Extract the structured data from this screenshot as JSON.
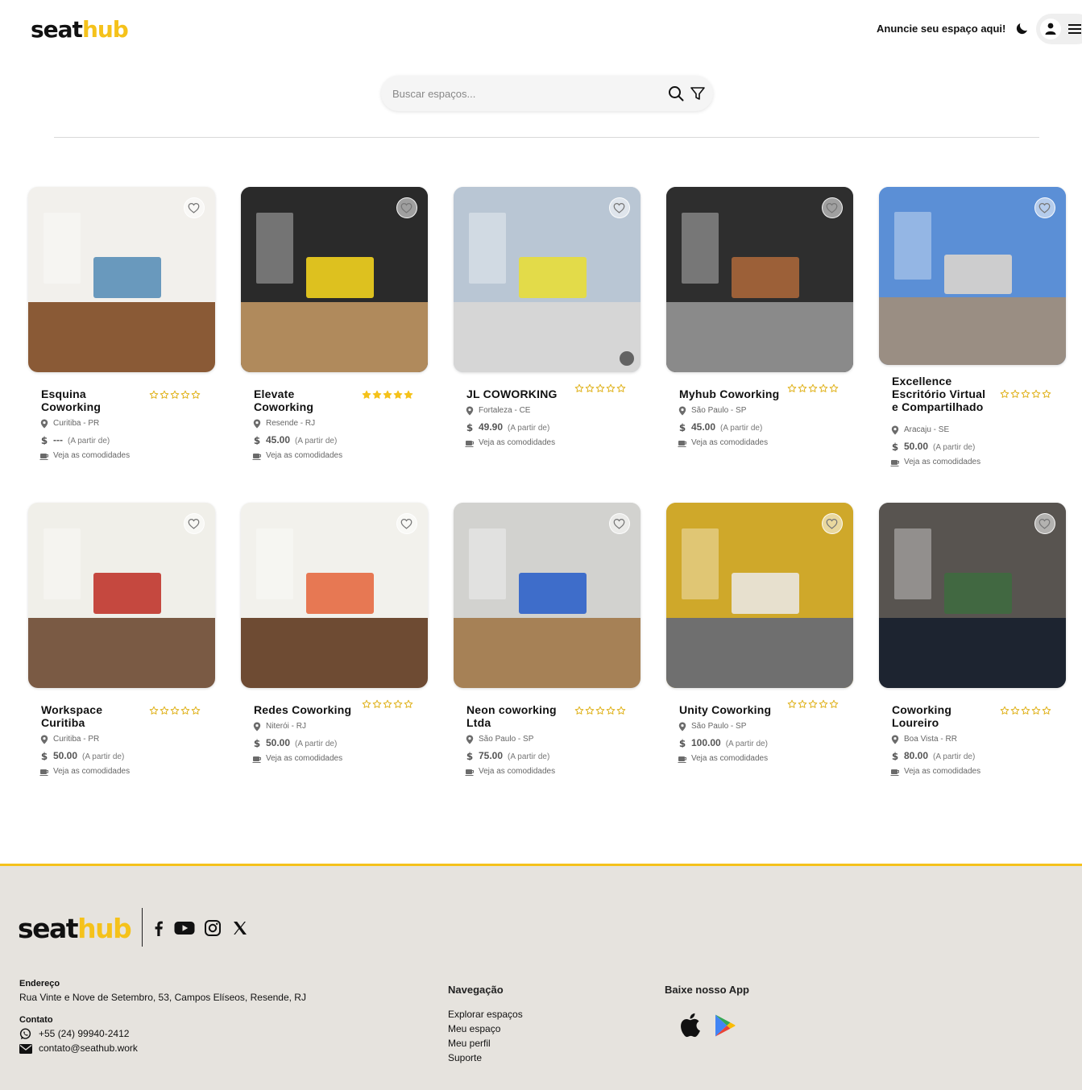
{
  "header": {
    "logo_seat": "seat",
    "logo_hub": "hub",
    "announce_label": "Anuncie seu espaço aqui!"
  },
  "search": {
    "placeholder": "Buscar espaços..."
  },
  "listing_labels": {
    "from": "(A partir de)",
    "amenities": "Veja as comodidades"
  },
  "listings": [
    {
      "name": "Esquina Coworking",
      "rating": 0,
      "location": "Curitiba - PR",
      "price": "---"
    },
    {
      "name": "Elevate Coworking",
      "rating": 5,
      "location": "Resende - RJ",
      "price": "45.00"
    },
    {
      "name": "JL COWORKING",
      "rating": 0,
      "location": "Fortaleza - CE",
      "price": "49.90"
    },
    {
      "name": "Myhub Coworking",
      "rating": 0,
      "location": "São Paulo - SP",
      "price": "45.00"
    },
    {
      "name": "Excellence Escritório Virtual e Compartilhado",
      "rating": 0,
      "location": "Aracaju - SE",
      "price": "50.00"
    },
    {
      "name": "Workspace Curitiba",
      "rating": 0,
      "location": "Curitiba - PR",
      "price": "50.00"
    },
    {
      "name": "Redes Coworking",
      "rating": 0,
      "location": "Niterói - RJ",
      "price": "50.00"
    },
    {
      "name": "Neon coworking Ltda",
      "rating": 0,
      "location": "São Paulo - SP",
      "price": "75.00"
    },
    {
      "name": "Unity Coworking",
      "rating": 0,
      "location": "São Paulo - SP",
      "price": "100.00"
    },
    {
      "name": "Coworking Loureiro",
      "rating": 0,
      "location": "Boa Vista - RR",
      "price": "80.00"
    }
  ],
  "footer": {
    "logo_seat": "seat",
    "logo_hub": "hub",
    "address_label": "Endereço",
    "address": "Rua Vinte e Nove de Setembro, 53, Campos Elíseos, Resende, RJ",
    "contact_label": "Contato",
    "phone": "+55 (24) 99940-2412",
    "email": "contato@seathub.work",
    "nav_title": "Navegação",
    "nav_links": [
      "Explorar espaços",
      "Meu espaço",
      "Meu perfil",
      "Suporte"
    ],
    "app_title": "Baixe nosso App"
  },
  "colors": {
    "brand_yellow": "#f5c21b",
    "star_filled": "#f5c21b",
    "footer_bg": "#e6e3de"
  }
}
